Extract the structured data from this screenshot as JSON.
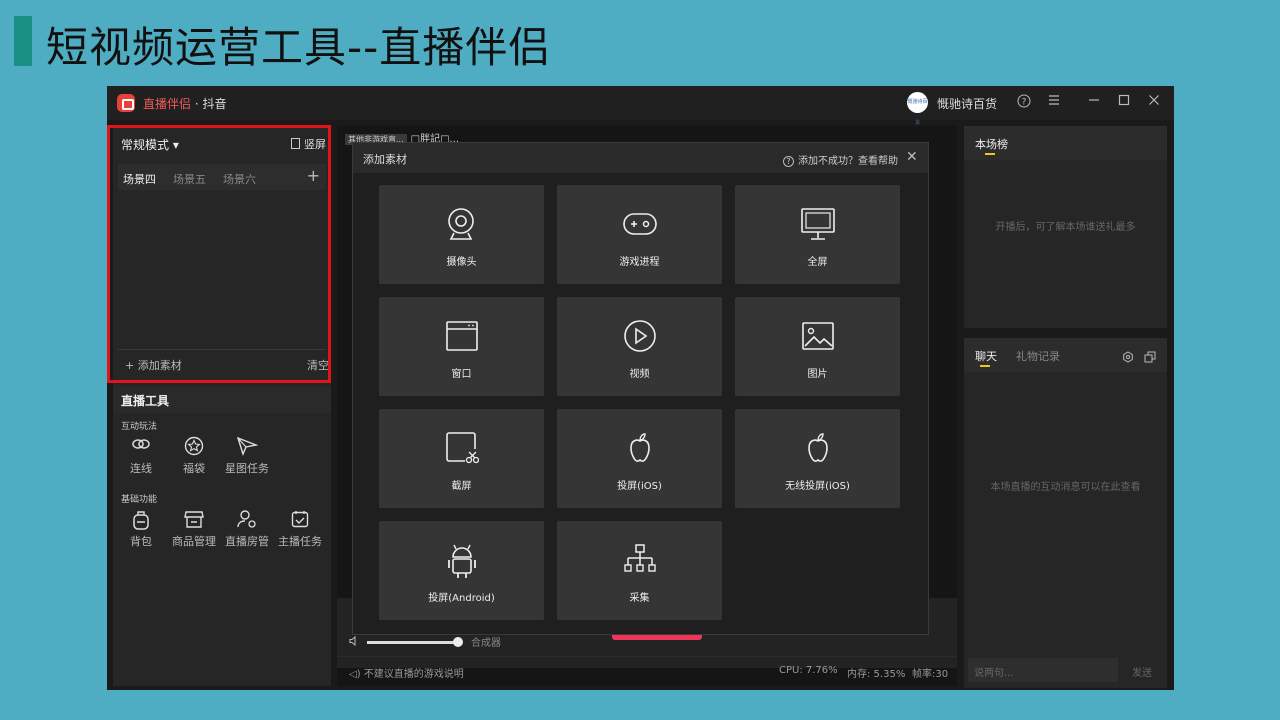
{
  "slide": {
    "title": "短视频运营工具--直播伴侣"
  },
  "app": {
    "name": "直播伴侣",
    "platform": "抖音",
    "user": {
      "name": "慨驰诗百货",
      "avatar_text": "慨驰诗百货"
    }
  },
  "left": {
    "mode": "常规模式 ▾",
    "portrait": "竖屏",
    "scene_tabs": [
      "场景四",
      "场景五",
      "场景六"
    ],
    "add_material": "添加素材",
    "clear": "清空"
  },
  "tools": {
    "title": "直播工具",
    "group1": "互动玩法",
    "group1_items": [
      "连线",
      "福袋",
      "星图任务"
    ],
    "group2": "基础功能",
    "group2_items": [
      "背包",
      "商品管理",
      "直播房管",
      "主播任务"
    ]
  },
  "center": {
    "tag": "其他非游戏直...",
    "scene_name": "□胖記□...",
    "mixer": "合成器",
    "status_note": "不建议直播的游戏说明",
    "cpu": "CPU: 7.76%",
    "memory": "内存: 5.35%",
    "fps": "帧率:30"
  },
  "right": {
    "rank_tab": "本场榜",
    "rank_hint": "开播后，可了解本场谁送礼最多",
    "chat_tab": "聊天",
    "gift_tab": "礼物记录",
    "chat_hint": "本场直播的互动消息可以在此查看",
    "chat_placeholder": "说两句...",
    "send": "发送"
  },
  "dialog": {
    "title": "添加素材",
    "help": "添加不成功？查看帮助",
    "tiles": [
      {
        "label": "摄像头",
        "icon": "camera-icon"
      },
      {
        "label": "游戏进程",
        "icon": "gamepad-icon"
      },
      {
        "label": "全屏",
        "icon": "monitor-icon"
      },
      {
        "label": "窗口",
        "icon": "window-icon"
      },
      {
        "label": "视频",
        "icon": "play-icon"
      },
      {
        "label": "图片",
        "icon": "image-icon"
      },
      {
        "label": "截屏",
        "icon": "crop-icon"
      },
      {
        "label": "投屏(iOS)",
        "icon": "apple-icon"
      },
      {
        "label": "无线投屏(iOS)",
        "icon": "apple-icon"
      },
      {
        "label": "投屏(Android)",
        "icon": "android-icon"
      },
      {
        "label": "采集",
        "icon": "capture-icon"
      }
    ]
  }
}
